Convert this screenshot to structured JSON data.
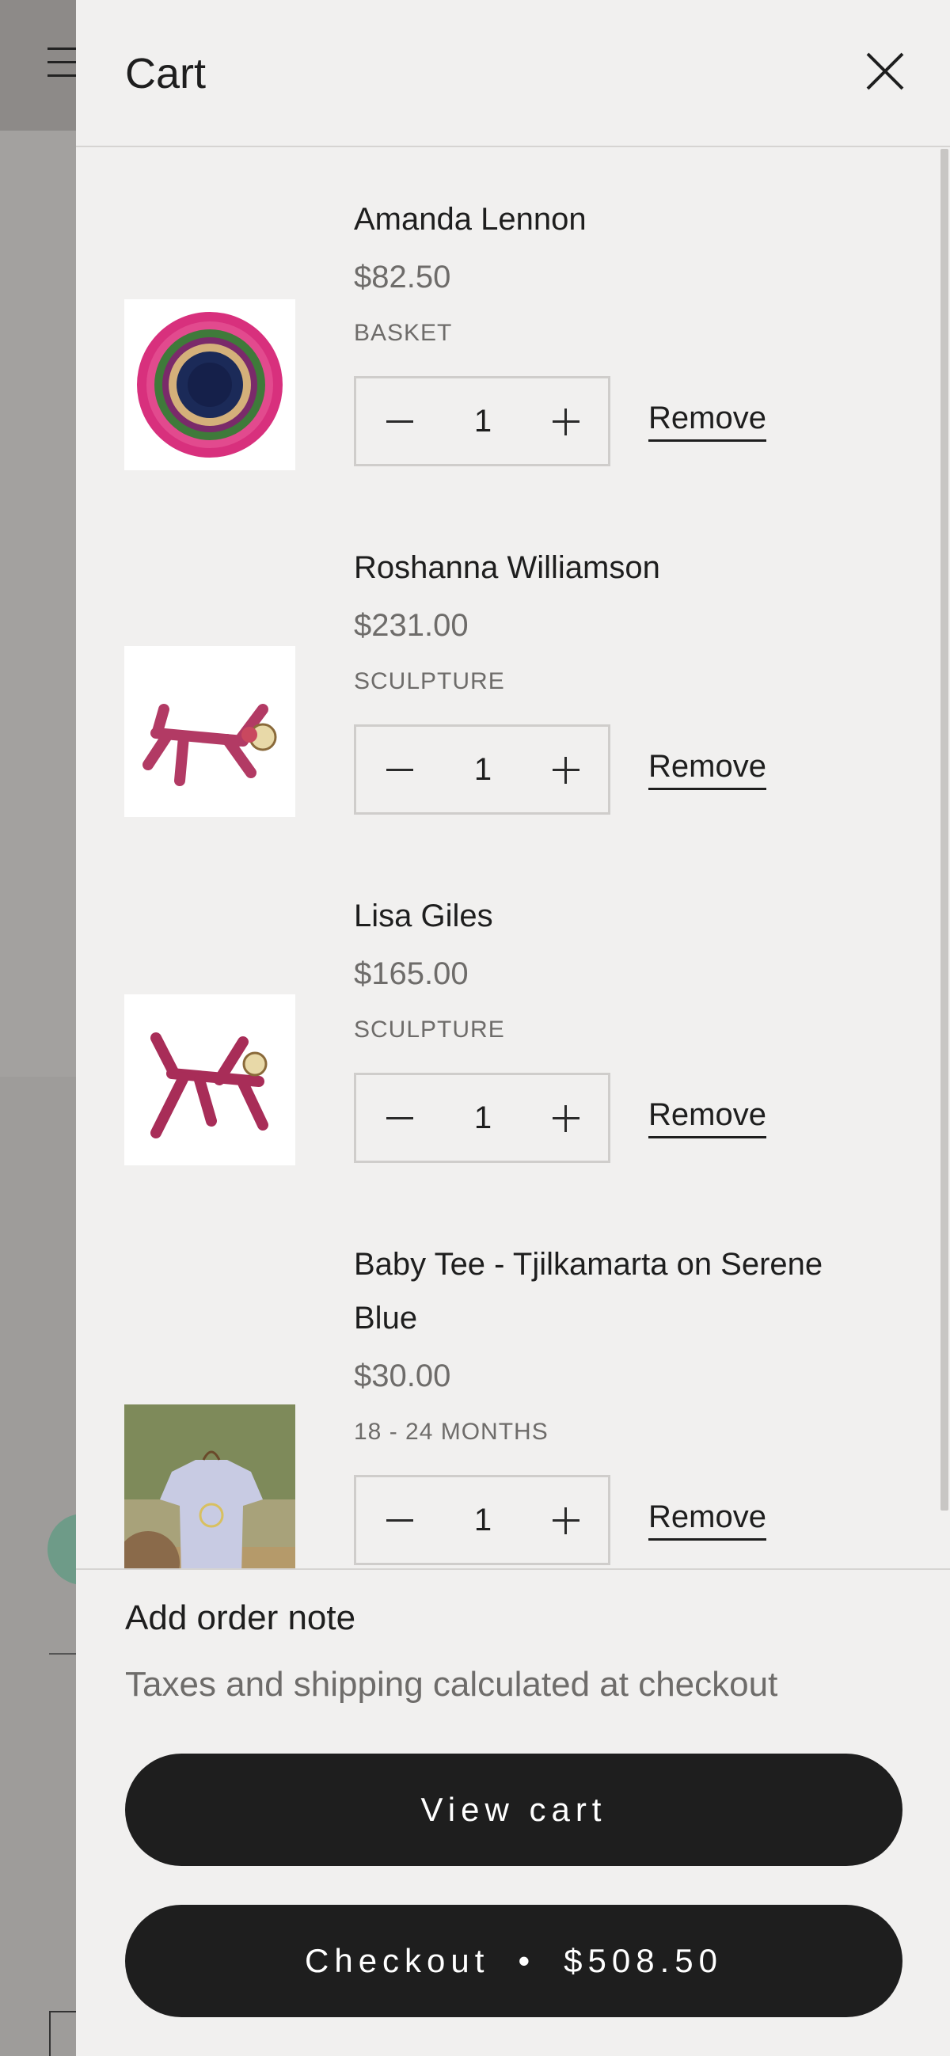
{
  "drawer": {
    "title": "Cart",
    "close_icon": "close-icon"
  },
  "items": [
    {
      "name": "Amanda Lennon",
      "price": "$82.50",
      "variant": "BASKET",
      "quantity": "1",
      "remove_label": "Remove"
    },
    {
      "name": "Roshanna Williamson",
      "price": "$231.00",
      "variant": "SCULPTURE",
      "quantity": "1",
      "remove_label": "Remove"
    },
    {
      "name": "Lisa Giles",
      "price": "$165.00",
      "variant": "SCULPTURE",
      "quantity": "1",
      "remove_label": "Remove"
    },
    {
      "name": "Baby Tee - Tjilkamarta on Serene Blue",
      "price": "$30.00",
      "variant": "18 - 24 MONTHS",
      "quantity": "1",
      "remove_label": "Remove"
    }
  ],
  "footer": {
    "order_note_label": "Add order note",
    "taxes_text": "Taxes and shipping calculated at checkout",
    "view_cart_label": "View cart",
    "checkout_label": "Checkout",
    "checkout_separator": "•",
    "checkout_total": "$508.50"
  },
  "colors": {
    "drawer_bg": "#f1f0ef",
    "button_bg": "#1e1e1e",
    "muted_text": "#6e6c6a",
    "overlay": "#9a9998"
  }
}
